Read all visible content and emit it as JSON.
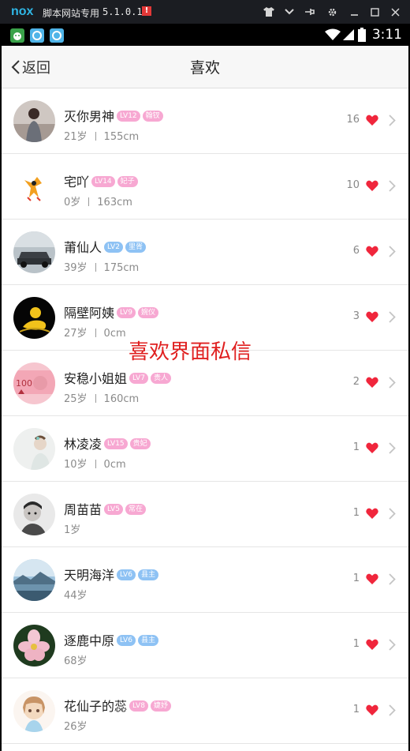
{
  "emulator": {
    "logo": "nox",
    "title": "脚本网站专用",
    "version": "5.1.0.1",
    "warn": "!"
  },
  "status": {
    "time": "3:11"
  },
  "nav": {
    "back_label": "返回",
    "title": "喜欢"
  },
  "watermark": "喜欢界面私信",
  "users": [
    {
      "name": "灭你男神",
      "level": "LV12",
      "tag": "翰钗",
      "level_color": "pink",
      "tag_color": "pink",
      "age": "21岁",
      "height": "155cm",
      "likes": "16"
    },
    {
      "name": "宅吖",
      "level": "LV14",
      "tag": "妃子",
      "level_color": "pink",
      "tag_color": "pink",
      "age": "0岁",
      "height": "163cm",
      "likes": "10"
    },
    {
      "name": "莆仙人",
      "level": "LV2",
      "tag": "里胥",
      "level_color": "blue",
      "tag_color": "blue",
      "age": "39岁",
      "height": "175cm",
      "likes": "6"
    },
    {
      "name": "隔壁阿姨",
      "level": "LV9",
      "tag": "婉仪",
      "level_color": "pink",
      "tag_color": "pink",
      "age": "27岁",
      "height": "0cm",
      "likes": "3"
    },
    {
      "name": "安稳小姐姐",
      "level": "LV7",
      "tag": "贵人",
      "level_color": "pink",
      "tag_color": "pink",
      "age": "25岁",
      "height": "160cm",
      "likes": "2"
    },
    {
      "name": "林凌凌",
      "level": "LV15",
      "tag": "贵妃",
      "level_color": "pink",
      "tag_color": "pink",
      "age": "10岁",
      "height": "0cm",
      "likes": "1"
    },
    {
      "name": "周苗苗",
      "level": "LV5",
      "tag": "常在",
      "level_color": "pink",
      "tag_color": "pink",
      "age": "1岁",
      "height": "",
      "likes": "1"
    },
    {
      "name": "天明海洋",
      "level": "LV6",
      "tag": "县主",
      "level_color": "blue",
      "tag_color": "blue",
      "age": "44岁",
      "height": "",
      "likes": "1"
    },
    {
      "name": "逐鹿中原",
      "level": "LV6",
      "tag": "县主",
      "level_color": "blue",
      "tag_color": "blue",
      "age": "68岁",
      "height": "",
      "likes": "1"
    },
    {
      "name": "花仙子的蕊",
      "level": "LV8",
      "tag": "婕妤",
      "level_color": "pink",
      "tag_color": "pink",
      "age": "26岁",
      "height": "",
      "likes": "1"
    }
  ],
  "colors": {
    "heart": "#f0263c",
    "nav_bg": "#f7f7f7",
    "badge_pink": "#f7a8d2",
    "badge_blue": "#8ec2f4"
  }
}
